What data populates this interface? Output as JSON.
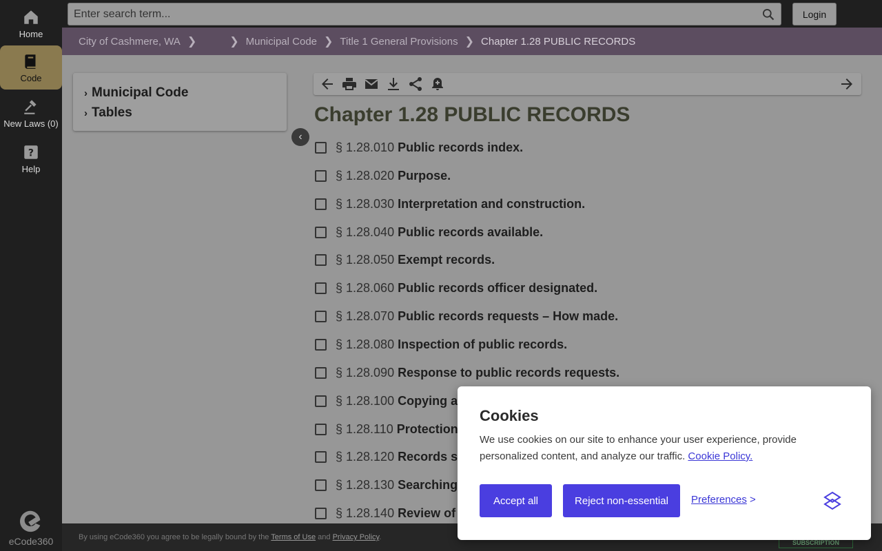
{
  "rail": {
    "items": [
      {
        "label": "Home",
        "icon": "home-icon"
      },
      {
        "label": "Code",
        "icon": "book-icon",
        "active": true
      },
      {
        "label": "New Laws (0)",
        "icon": "gavel-icon"
      },
      {
        "label": "Help",
        "icon": "help-icon"
      }
    ],
    "brand": "eCode360"
  },
  "search": {
    "placeholder": "Enter search term...",
    "value": ""
  },
  "login_label": "Login",
  "breadcrumb": {
    "items": [
      "City of Cashmere, WA",
      "Municipal Code",
      "Title 1 General Provisions"
    ],
    "current": "Chapter 1.28 PUBLIC RECORDS"
  },
  "toc": {
    "items": [
      "Municipal Code",
      "Tables"
    ]
  },
  "chapter": {
    "prefix": "Chapter 1.28",
    "title": "PUBLIC RECORDS"
  },
  "sections": [
    {
      "num": "§ 1.28.010",
      "title": "Public records index."
    },
    {
      "num": "§ 1.28.020",
      "title": "Purpose."
    },
    {
      "num": "§ 1.28.030",
      "title": "Interpretation and construction."
    },
    {
      "num": "§ 1.28.040",
      "title": "Public records available."
    },
    {
      "num": "§ 1.28.050",
      "title": "Exempt records."
    },
    {
      "num": "§ 1.28.060",
      "title": "Public records officer designated."
    },
    {
      "num": "§ 1.28.070",
      "title": "Public records requests – How made."
    },
    {
      "num": "§ 1.28.080",
      "title": "Inspection of public records."
    },
    {
      "num": "§ 1.28.090",
      "title": "Response to public records requests."
    },
    {
      "num": "§ 1.28.100",
      "title": "Copying ar"
    },
    {
      "num": "§ 1.28.110",
      "title": "Protection"
    },
    {
      "num": "§ 1.28.120",
      "title": "Records sc"
    },
    {
      "num": "§ 1.28.130",
      "title": "Searching"
    },
    {
      "num": "§ 1.28.140",
      "title": "Review of"
    }
  ],
  "footer": {
    "prefix": "By using eCode360 you agree to be legally bound by the",
    "terms": "Terms of Use",
    "and": "and",
    "privacy": "Privacy Policy",
    "suffix": ".",
    "badge": "SUBSCRIPTION"
  },
  "cookie": {
    "title": "Cookies",
    "body": "We use cookies on our site to enhance your user experience, provide personalized content, and analyze our traffic.",
    "policy_link": "Cookie Policy.",
    "accept": "Accept all",
    "reject": "Reject non-essential",
    "preferences": "Preferences",
    "preferences_arrow": ">"
  },
  "colors": {
    "accent": "#4a3ee0",
    "breadcrumb_bg": "#5c4d60",
    "rail_active": "#8a7a4f"
  }
}
